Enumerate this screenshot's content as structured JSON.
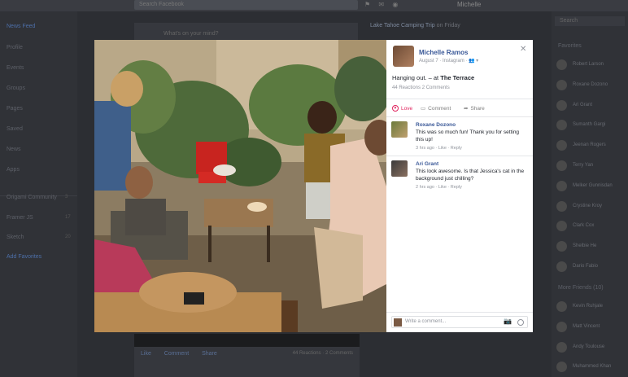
{
  "topbar": {
    "search_placeholder": "Search Facebook",
    "user_name": "Michelle"
  },
  "left_nav": {
    "items": [
      {
        "label": "News Feed",
        "active": true
      },
      {
        "label": "Profile"
      },
      {
        "label": "Events"
      },
      {
        "label": "Groups"
      },
      {
        "label": "Pages"
      },
      {
        "label": "Saved"
      },
      {
        "label": "News"
      },
      {
        "label": "Apps"
      }
    ],
    "groups": [
      {
        "label": "Origami Community",
        "count": "3"
      },
      {
        "label": "Framer JS",
        "count": "17"
      },
      {
        "label": "Sketch",
        "count": "20"
      }
    ],
    "add_favorites": "Add Favorites"
  },
  "feed": {
    "composer_placeholder": "What's on your mind?",
    "post_actions": [
      "Like",
      "Comment",
      "Share"
    ],
    "post_stats": "44 Reactions · 2 Comments"
  },
  "event": {
    "title": "Lake Tahoe Camping Trip",
    "suffix": "on Friday"
  },
  "right_panel": {
    "search_placeholder": "Search",
    "favorites_heading": "Favorites",
    "favorites": [
      "Robert Larson",
      "Roxane Dozono",
      "Ari Grant",
      "Sumanth Gargi",
      "Jeenan Rogers",
      "Terry Yan",
      "Melker Gunnisdan",
      "Crystine Kroy",
      "Clark Cox",
      "Shelbie He",
      "Dario Fabio"
    ],
    "more_heading": "More Friends (10)",
    "more_friends": [
      "Kevin Ruhjale",
      "Matt Vincent",
      "Andy Toulouse",
      "Muhammed Khan"
    ]
  },
  "panel": {
    "author": "Michelle Ramos",
    "meta": "August 7 · Instagram · ",
    "status_text": "Hanging out.",
    "status_at": " – at ",
    "location": "The Terrace",
    "stats": "44 Reactions  2 Comments",
    "actions": {
      "love": "Love",
      "comment": "Comment",
      "share": "Share"
    },
    "comments": [
      {
        "name": "Roxane Dozono",
        "text": "This was so much fun! Thank you for setting this up!",
        "meta": "3 hrs ago · Like · Reply"
      },
      {
        "name": "Ari Grant",
        "text": "This look awesome. Is that Jessica's cat in the background just chilling?",
        "meta": "2 hrs ago · Like · Reply"
      }
    ],
    "write_placeholder": "Write a comment..."
  },
  "colors": {
    "link": "#3b5998",
    "love": "#e0245e",
    "muted": "#90949c",
    "backdrop": "#2c2e33"
  }
}
